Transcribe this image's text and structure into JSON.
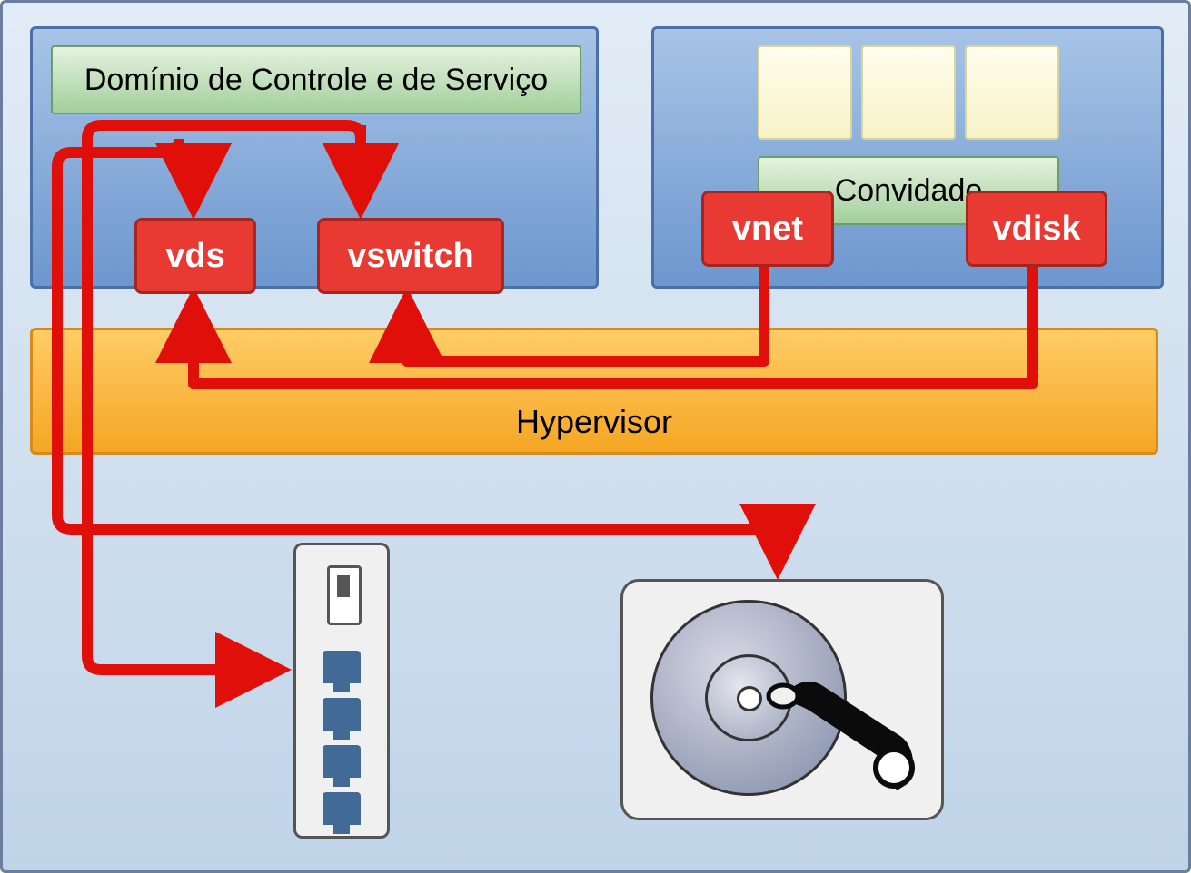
{
  "control_domain": {
    "title": "Domínio de Controle e de Serviço"
  },
  "guest_domain": {
    "title": "Convidado"
  },
  "components": {
    "vds": "vds",
    "vswitch": "vswitch",
    "vnet": "vnet",
    "vdisk": "vdisk"
  },
  "hypervisor": {
    "label": "Hypervisor"
  },
  "colors": {
    "red": "#e83a33",
    "orange": "#f5a623",
    "blue_panel": "#6d97cf",
    "green_box": "#a2cf9a",
    "background": "#c0d4e8"
  }
}
